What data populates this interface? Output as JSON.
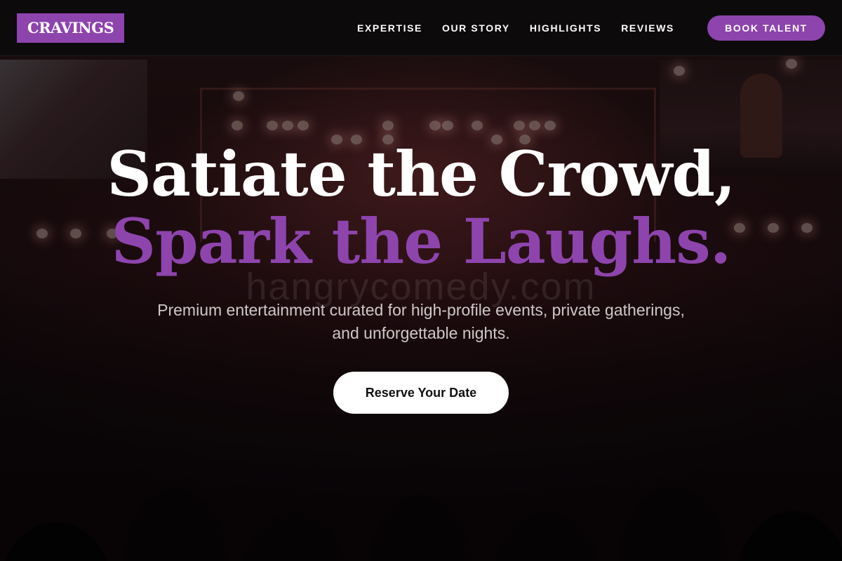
{
  "nav": {
    "logo": "CRAVINGS",
    "links": [
      "EXPERTISE",
      "OUR STORY",
      "HIGHLIGHTS",
      "REVIEWS"
    ],
    "cta": "BOOK TALENT"
  },
  "hero": {
    "title_line1": "Satiate the Crowd,",
    "title_line2": "Spark the Laughs.",
    "subtitle": "Premium entertainment curated for high-profile events, private gatherings, and unforgettable nights.",
    "cta": "Reserve Your Date"
  },
  "watermark": "hangrycomedy.com",
  "colors": {
    "accent": "#8e44ad",
    "nav_bg": "#0c0a0c",
    "text": "#ffffff",
    "cta_bg": "#ffffff"
  }
}
